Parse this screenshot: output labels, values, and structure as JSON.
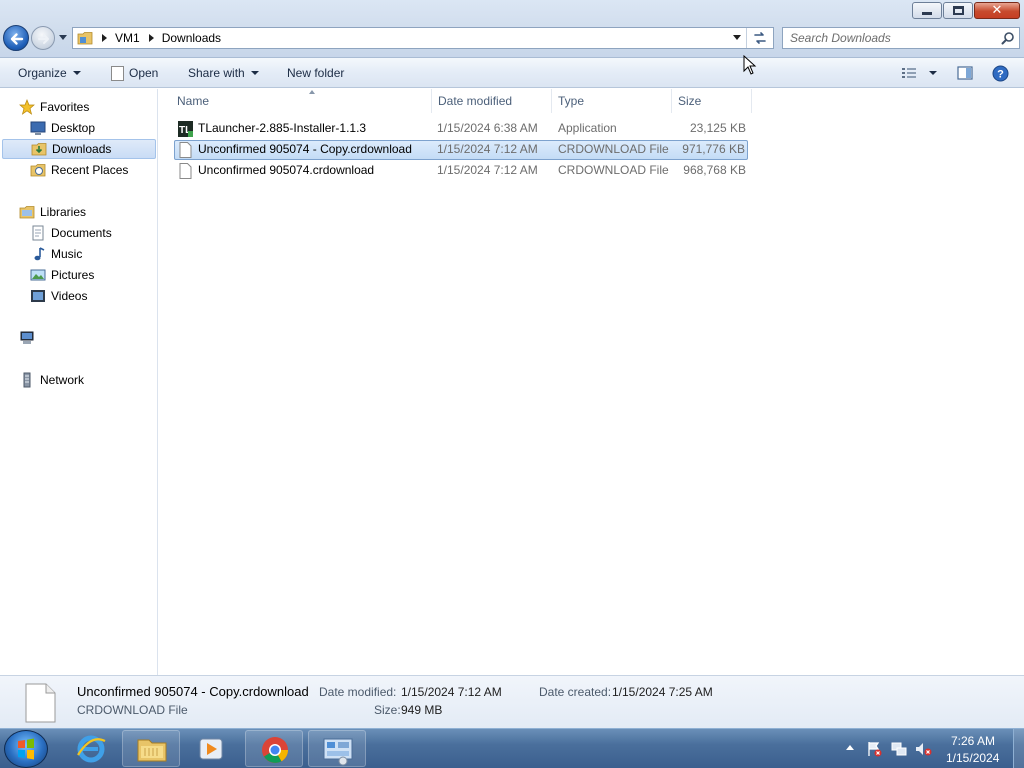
{
  "window": {
    "minimize_glyph": "minimize",
    "maximize_glyph": "maximize",
    "close_glyph": "✕"
  },
  "address_bar": {
    "crumbs": [
      "VM1",
      "Downloads"
    ]
  },
  "search": {
    "placeholder": "Search Downloads"
  },
  "toolbar": {
    "organize": "Organize",
    "open": "Open",
    "share_with": "Share with",
    "new_folder": "New folder"
  },
  "nav": {
    "favorites": "Favorites",
    "desktop": "Desktop",
    "downloads": "Downloads",
    "recent_places": "Recent Places",
    "libraries": "Libraries",
    "documents": "Documents",
    "music": "Music",
    "pictures": "Pictures",
    "videos": "Videos",
    "network": "Network"
  },
  "columns": {
    "name": "Name",
    "date_modified": "Date modified",
    "type": "Type",
    "size": "Size"
  },
  "files": [
    {
      "name": "TLauncher-2.885-Installer-1.1.3",
      "date": "1/15/2024 6:38 AM",
      "type": "Application",
      "size": "23,125 KB",
      "icon": "tlauncher-app-icon",
      "selected": false
    },
    {
      "name": "Unconfirmed 905074 - Copy.crdownload",
      "date": "1/15/2024 7:12 AM",
      "type": "CRDOWNLOAD File",
      "size": "971,776 KB",
      "icon": "blank-file-icon",
      "selected": true
    },
    {
      "name": "Unconfirmed 905074.crdownload",
      "date": "1/15/2024 7:12 AM",
      "type": "CRDOWNLOAD File",
      "size": "968,768 KB",
      "icon": "blank-file-icon",
      "selected": false
    }
  ],
  "details": {
    "file_name": "Unconfirmed 905074 - Copy.crdownload",
    "file_type": "CRDOWNLOAD File",
    "date_modified_label": "Date modified:",
    "date_modified_value": "1/15/2024 7:12 AM",
    "date_created_label": "Date created:",
    "date_created_value": "1/15/2024 7:25 AM",
    "size_label": "Size:",
    "size_value": "949 MB"
  },
  "taskbar": {
    "time": "7:26 AM",
    "date": "1/15/2024",
    "apps": [
      "internet-explorer-icon",
      "windows-explorer-icon",
      "media-player-icon",
      "chrome-icon",
      "control-panel-icon"
    ]
  },
  "colors": {
    "selection": "#cce0f7",
    "selection_border": "#7da2ce",
    "header_text": "#4c607a",
    "secondary_text": "#6d6d6d"
  }
}
